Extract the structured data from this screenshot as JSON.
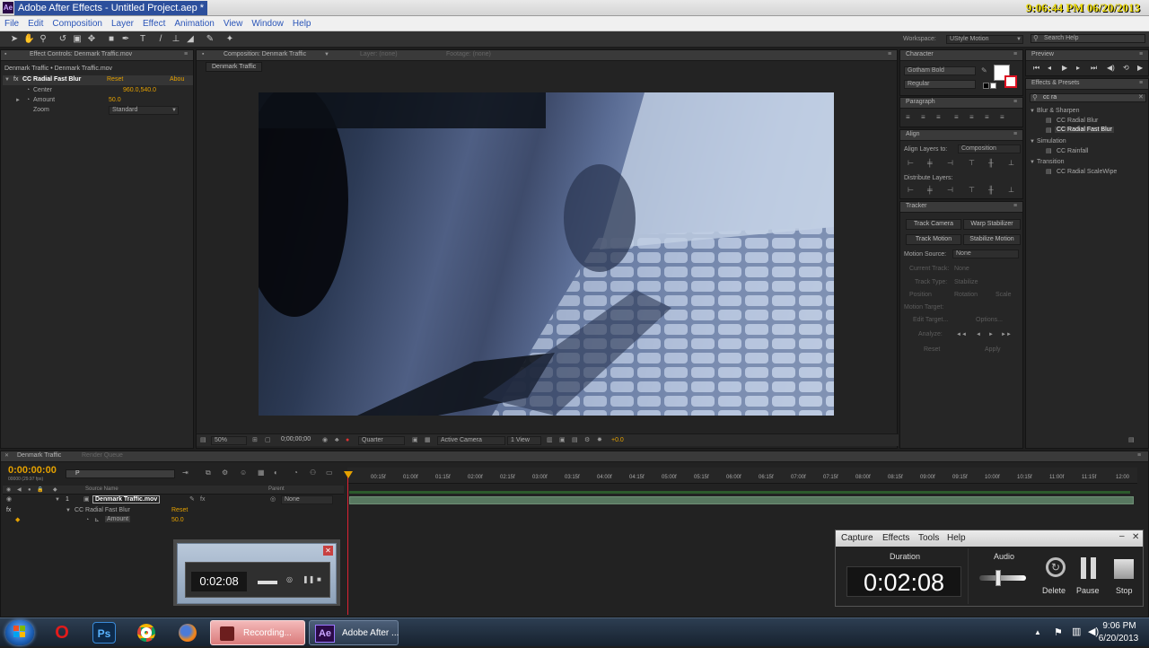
{
  "window": {
    "title": "Adobe After Effects - Untitled Project.aep *",
    "clock": "9:06:44 PM 06/20/2013",
    "app_icon": "Ae"
  },
  "menu": [
    "File",
    "Edit",
    "Composition",
    "Layer",
    "Effect",
    "Animation",
    "View",
    "Window",
    "Help"
  ],
  "workspace": {
    "label": "Workspace:",
    "value": "UStyle Motion",
    "search_placeholder": "Search Help"
  },
  "effect_controls": {
    "tab": "Effect Controls: Denmark Traffic.mov",
    "breadcrumb": "Denmark Traffic • Denmark Traffic.mov",
    "effect_name": "CC Radial Fast Blur",
    "reset": "Reset",
    "about": "Abou",
    "props": [
      {
        "name": "Center",
        "value": "960.0,540.0"
      },
      {
        "name": "Amount",
        "value": "50.0"
      },
      {
        "name": "Zoom",
        "value": "Standard"
      }
    ]
  },
  "composition": {
    "tab": "Composition: Denmark Traffic",
    "layer_tab": "Layer: (none)",
    "footage_tab": "Footage: (none)",
    "subtab": "Denmark Traffic",
    "footer": {
      "zoom": "50%",
      "timecode": "0;00;00;00",
      "resolution": "Quarter",
      "camera": "Active Camera",
      "views": "1 View",
      "exposure": "+0.0"
    }
  },
  "character": {
    "tab": "Character",
    "font": "Gotham Bold",
    "style": "Regular"
  },
  "paragraph": {
    "tab": "Paragraph"
  },
  "align": {
    "tab": "Align",
    "align_to_label": "Align Layers to:",
    "align_to_value": "Composition",
    "distribute": "Distribute Layers:"
  },
  "tracker": {
    "tab": "Tracker",
    "buttons": [
      "Track Camera",
      "Warp Stabilizer",
      "Track Motion",
      "Stabilize Motion"
    ],
    "motion_source_label": "Motion Source:",
    "motion_source_value": "None",
    "disabled": [
      "Current Track:",
      "None",
      "Track Type:",
      "Stabilize",
      "Position",
      "Rotation",
      "Scale",
      "Motion Target:",
      "Edit Target...",
      "Options...",
      "Analyze:",
      "Reset",
      "Apply"
    ]
  },
  "preview": {
    "tab": "Preview"
  },
  "effects_presets": {
    "tab": "Effects & Presets",
    "search": "cc ra",
    "tree": [
      {
        "label": "Blur & Sharpen",
        "level": 0
      },
      {
        "label": "CC Radial Blur",
        "level": 1
      },
      {
        "label": "CC Radial Fast Blur",
        "level": 1,
        "selected": true
      },
      {
        "label": "Simulation",
        "level": 0
      },
      {
        "label": "CC Rainfall",
        "level": 1
      },
      {
        "label": "Transition",
        "level": 0
      },
      {
        "label": "CC Radial ScaleWipe",
        "level": 1
      }
    ]
  },
  "timeline": {
    "tab": "Denmark Traffic",
    "render_tab": "Render Queue",
    "timecode": "0:00:00:00",
    "fps": "00000 (29.97 fps)",
    "search_placeholder": "P",
    "col_source": "Source Name",
    "col_parent": "Parent",
    "layer_num": "1",
    "layer_name": "Denmark Traffic.mov",
    "parent_value": "None",
    "effect_row": "CC Radial Fast Blur",
    "effect_reset": "Reset",
    "amount_row": "Amount",
    "amount_value": "50.0",
    "ruler": [
      "00:15f",
      "01:00f",
      "01:15f",
      "02:00f",
      "02:15f",
      "03:00f",
      "03:15f",
      "04:00f",
      "04:15f",
      "05:00f",
      "05:15f",
      "06:00f",
      "06:15f",
      "07:00f",
      "07:15f",
      "08:00f",
      "08:15f",
      "09:00f",
      "09:15f",
      "10:00f",
      "10:15f",
      "11:00f",
      "11:15f",
      "12:00"
    ]
  },
  "recorder": {
    "menu": [
      "Capture",
      "Effects",
      "Tools",
      "Help"
    ],
    "duration_label": "Duration",
    "duration": "0:02:08",
    "audio_label": "Audio",
    "buttons": [
      "Delete",
      "Pause",
      "Stop"
    ]
  },
  "thumbnail": {
    "duration": "0:02:08"
  },
  "taskbar": {
    "tasks": [
      {
        "label": "Recording...",
        "icon": "recorder-icon"
      },
      {
        "label": "Adobe After ...",
        "icon": "Ae"
      }
    ],
    "pinned": [
      "opera-icon",
      "photoshop-icon",
      "chrome-icon",
      "firefox-icon"
    ],
    "ps_label": "Ps",
    "time": "9:06 PM",
    "date": "6/20/2013"
  }
}
